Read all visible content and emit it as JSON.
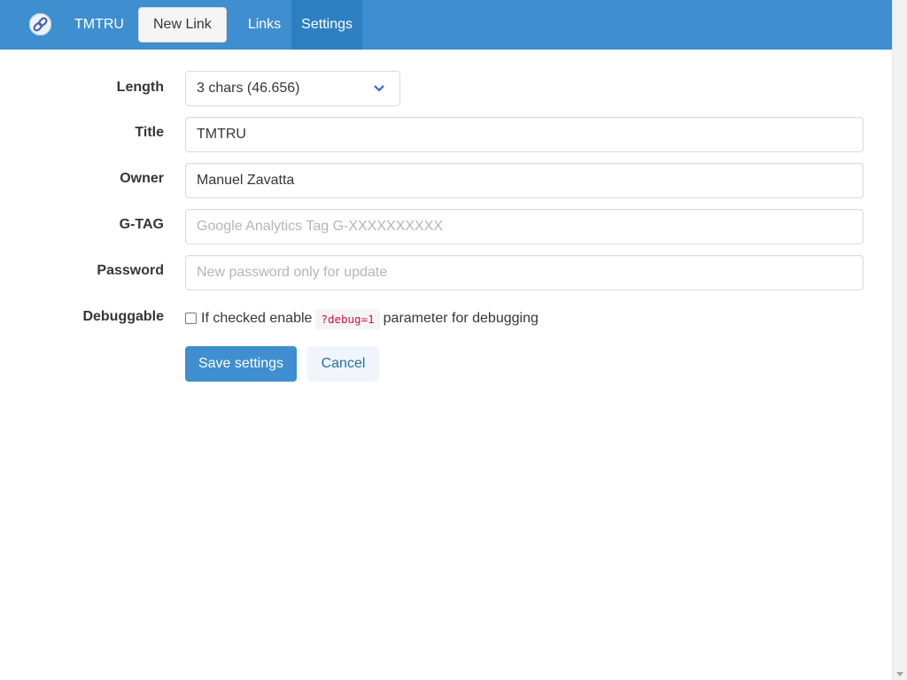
{
  "nav": {
    "brand": "TMTRU",
    "new_link": "New Link",
    "links": "Links",
    "settings": "Settings"
  },
  "form": {
    "length": {
      "label": "Length",
      "value": "3 chars (46.656)"
    },
    "title": {
      "label": "Title",
      "value": "TMTRU"
    },
    "owner": {
      "label": "Owner",
      "value": "Manuel Zavatta"
    },
    "gtag": {
      "label": "G-TAG",
      "placeholder": "Google Analytics Tag G-XXXXXXXXXX"
    },
    "password": {
      "label": "Password",
      "placeholder": "New password only for update"
    },
    "debuggable": {
      "label": "Debuggable",
      "text_before": "If checked enable",
      "code": "?debug=1",
      "text_after": "parameter for debugging",
      "checked": false
    }
  },
  "actions": {
    "save": "Save settings",
    "cancel": "Cancel"
  },
  "colors": {
    "primary": "#3e8ed0",
    "active_nav": "#2e7fc2",
    "code_text": "#da1039"
  }
}
